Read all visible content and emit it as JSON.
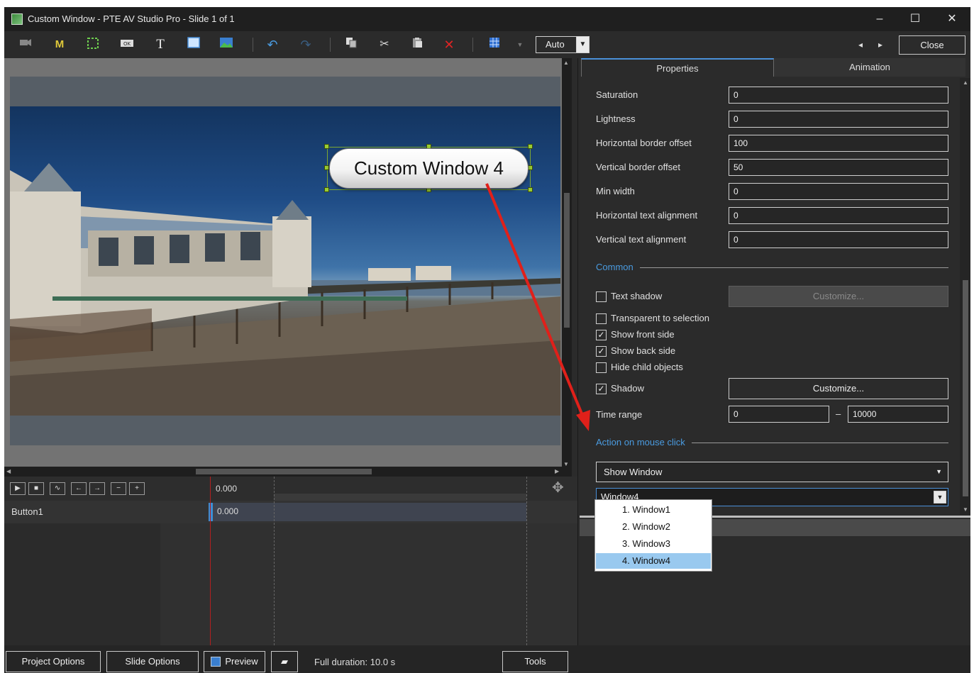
{
  "window": {
    "title": "Custom Window - PTE AV Studio Pro - Slide 1 of 1",
    "minimize": "–",
    "maximize": "☐",
    "close": "✕"
  },
  "toolbar": {
    "zoom_value": "Auto",
    "nav_prev": "◂",
    "nav_next": "▸",
    "close_label": "Close",
    "tools": [
      "camera-icon",
      "mask-icon",
      "frame-icon",
      "button-icon",
      "text-icon",
      "rectangle-icon",
      "image-icon",
      "undo-icon",
      "redo-icon",
      "copy-icon",
      "cut-icon",
      "paste-icon",
      "delete-icon",
      "grid-icon",
      "grid-dropdown-icon"
    ]
  },
  "canvas": {
    "button_text": "Custom Window 4"
  },
  "timeline": {
    "time": "0.000",
    "row_name": "Button1",
    "row_time": "0.000"
  },
  "panel": {
    "tabs": [
      "Properties",
      "Animation"
    ],
    "fields": [
      {
        "label": "Saturation",
        "value": "0"
      },
      {
        "label": "Lightness",
        "value": "0"
      },
      {
        "label": "Horizontal border offset",
        "value": "100"
      },
      {
        "label": "Vertical border offset",
        "value": "50"
      },
      {
        "label": "Min width",
        "value": "0"
      },
      {
        "label": "Horizontal text alignment",
        "value": "0"
      },
      {
        "label": "Vertical text alignment",
        "value": "0"
      }
    ],
    "common_header": "Common",
    "text_shadow": {
      "label": "Text shadow",
      "checked": false,
      "button": "Customize..."
    },
    "checkboxes": [
      {
        "label": "Transparent to selection",
        "checked": false
      },
      {
        "label": "Show front side",
        "checked": true
      },
      {
        "label": "Show back side",
        "checked": true
      },
      {
        "label": "Hide child objects",
        "checked": false
      }
    ],
    "shadow": {
      "label": "Shadow",
      "checked": true,
      "button": "Customize..."
    },
    "time_range": {
      "label": "Time range",
      "from": "0",
      "dash": "–",
      "to": "10000"
    },
    "action_header": "Action on mouse click",
    "action_value": "Show Window",
    "window_value": "Window4"
  },
  "dropdown": {
    "items": [
      "1. Window1",
      "2. Window2",
      "3. Window3",
      "4. Window4"
    ],
    "selected_index": 3
  },
  "status": {
    "project_options": "Project Options",
    "slide_options": "Slide Options",
    "preview": "Preview",
    "duration": "Full duration: 10.0 s",
    "tools": "Tools"
  },
  "colors": {
    "accent": "#4a9be0",
    "selection": "#99c9ef",
    "annotation": "#e0201a"
  }
}
